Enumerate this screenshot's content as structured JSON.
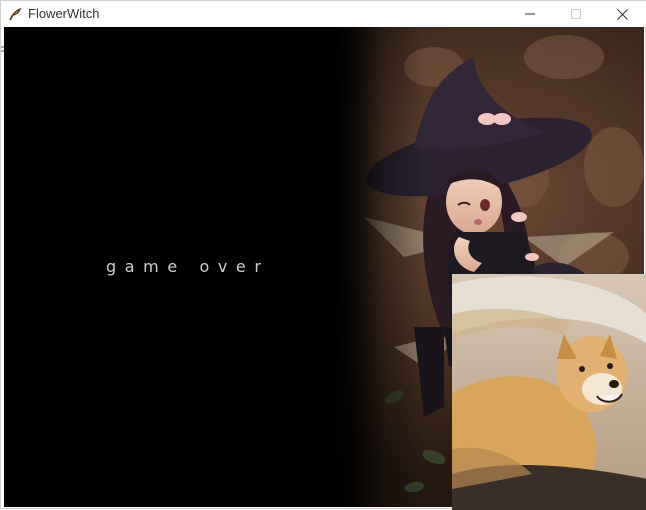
{
  "window": {
    "title": "FlowerWitch",
    "icon": "flower-witch-app-icon",
    "controls": {
      "minimize_icon": "minimize-icon",
      "maximize_icon": "maximize-icon",
      "close_icon": "close-icon"
    }
  },
  "game": {
    "status_text": "game over",
    "background": "witch-girl-illustration"
  },
  "overlay": {
    "image": "shiba-dog-photo"
  },
  "colors": {
    "title_text": "#333333",
    "game_background": "#000000",
    "game_over_text": "#cfcfcf"
  }
}
